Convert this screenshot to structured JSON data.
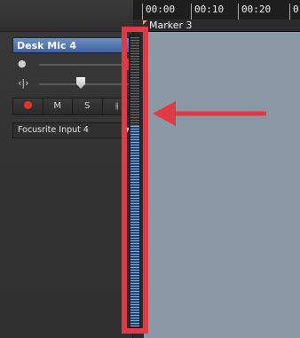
{
  "track": {
    "name": "Desk Mic 4",
    "buttons": {
      "mute": "M",
      "solo": "S",
      "fx": "⫲"
    },
    "input_source": "Focusrite Input 4"
  },
  "timeline": {
    "ticks": [
      "00:00",
      "00:10",
      "00:20",
      "0"
    ],
    "marker": "Marker 3"
  },
  "icons": {
    "volume": "microphone-icon",
    "pan": "pan-icon",
    "record": "record-icon",
    "dropdown": "chevron-down-icon",
    "marker": "marker-flag-icon",
    "annotation": "arrow-left-icon"
  },
  "colors": {
    "track_selected": "#4a6fae",
    "record": "#e3342b",
    "annotation": "#e23a45",
    "meter_signal": "#7faee9",
    "clip_area": "#8b98a5"
  }
}
